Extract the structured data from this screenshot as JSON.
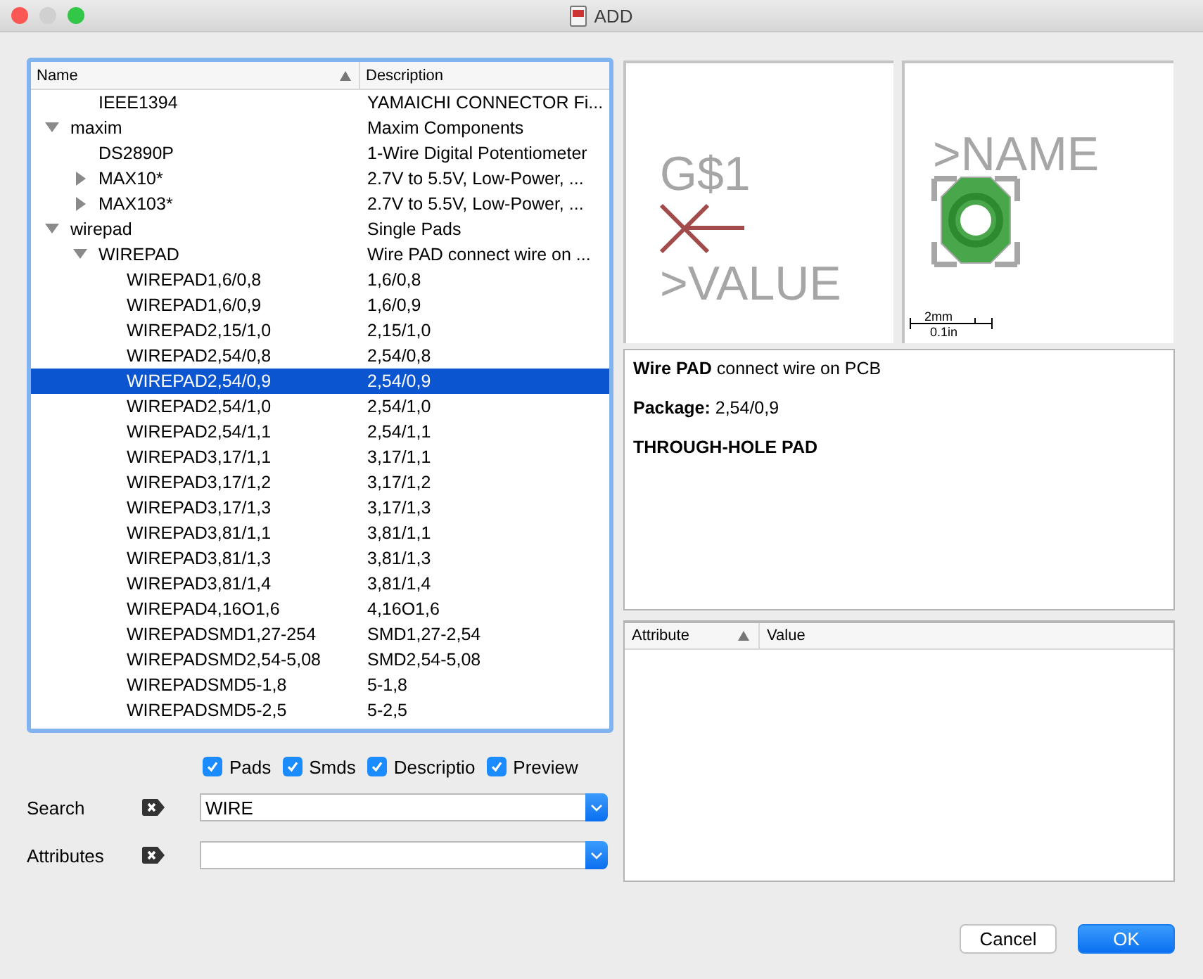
{
  "window": {
    "title": "ADD"
  },
  "tree": {
    "columns": [
      {
        "label": "Name",
        "sorted": true
      },
      {
        "label": "Description",
        "sorted": false
      }
    ],
    "items": [
      {
        "children": [
          {
            "name": "IEEE1394",
            "description": "YAMAICHI CONNECTOR Fi...",
            "selected": false
          }
        ]
      },
      {
        "name": "maxim",
        "description": "Maxim Components",
        "expanded": true,
        "selected": false,
        "children": [
          {
            "name": "DS2890P",
            "description": "1-Wire Digital Potentiometer",
            "selected": false
          },
          {
            "name": "MAX10*",
            "description": "2.7V to 5.5V, Low-Power, ...",
            "expanded": false,
            "selected": false
          },
          {
            "name": "MAX103*",
            "description": "2.7V to 5.5V, Low-Power, ...",
            "expanded": false,
            "selected": false
          }
        ]
      },
      {
        "name": "wirepad",
        "description": "Single Pads",
        "expanded": true,
        "selected": false,
        "children": [
          {
            "name": "WIREPAD",
            "description": "Wire PAD connect wire on ...",
            "expanded": true,
            "selected": false,
            "children": [
              {
                "name": "WIREPAD1,6/0,8",
                "description": "1,6/0,8",
                "selected": false
              },
              {
                "name": "WIREPAD1,6/0,9",
                "description": "1,6/0,9",
                "selected": false
              },
              {
                "name": "WIREPAD2,15/1,0",
                "description": "2,15/1,0",
                "selected": false
              },
              {
                "name": "WIREPAD2,54/0,8",
                "description": "2,54/0,8",
                "selected": false
              },
              {
                "name": "WIREPAD2,54/0,9",
                "description": "2,54/0,9",
                "selected": true
              },
              {
                "name": "WIREPAD2,54/1,0",
                "description": "2,54/1,0",
                "selected": false
              },
              {
                "name": "WIREPAD2,54/1,1",
                "description": "2,54/1,1",
                "selected": false
              },
              {
                "name": "WIREPAD3,17/1,1",
                "description": "3,17/1,1",
                "selected": false
              },
              {
                "name": "WIREPAD3,17/1,2",
                "description": "3,17/1,2",
                "selected": false
              },
              {
                "name": "WIREPAD3,17/1,3",
                "description": "3,17/1,3",
                "selected": false
              },
              {
                "name": "WIREPAD3,81/1,1",
                "description": "3,81/1,1",
                "selected": false
              },
              {
                "name": "WIREPAD3,81/1,3",
                "description": "3,81/1,3",
                "selected": false
              },
              {
                "name": "WIREPAD3,81/1,4",
                "description": "3,81/1,4",
                "selected": false
              },
              {
                "name": "WIREPAD4,16O1,6",
                "description": "4,16O1,6",
                "selected": false
              },
              {
                "name": "WIREPADSMD1,27-254",
                "description": "SMD1,27-2,54",
                "selected": false
              },
              {
                "name": "WIREPADSMD2,54-5,08",
                "description": "SMD2,54-5,08",
                "selected": false
              },
              {
                "name": "WIREPADSMD5-1,8",
                "description": "5-1,8",
                "selected": false
              },
              {
                "name": "WIREPADSMD5-2,5",
                "description": "5-2,5",
                "selected": false
              }
            ]
          }
        ]
      }
    ]
  },
  "filters": [
    {
      "label": "Pads",
      "checked": true
    },
    {
      "label": "Smds",
      "checked": true
    },
    {
      "label": "Descriptio",
      "checked": true
    },
    {
      "label": "Preview",
      "checked": true
    }
  ],
  "search": {
    "label": "Search",
    "value": "WIRE"
  },
  "attributes_filter": {
    "label": "Attributes"
  },
  "symbol_preview": {
    "name": "G$1",
    "value": ">VALUE"
  },
  "package_preview": {
    "name": ">NAME",
    "scale_metric": "2mm",
    "scale_imperial": "0.1in"
  },
  "description": [
    {
      "kind": "text",
      "text": "**Wire PAD** connect wire on PCB"
    },
    {
      "kind": "text",
      "text": "**Package:** 2,54/0,9"
    },
    {
      "kind": "heading",
      "text": "THROUGH-HOLE PAD"
    }
  ],
  "attribute_table": {
    "columns": [
      {
        "label": "Attribute",
        "sorted": true
      },
      {
        "label": "Value",
        "sorted": false
      }
    ]
  },
  "buttons": [
    {
      "label": "Cancel",
      "kind": "secondary"
    },
    {
      "label": "OK",
      "kind": "primary"
    }
  ]
}
